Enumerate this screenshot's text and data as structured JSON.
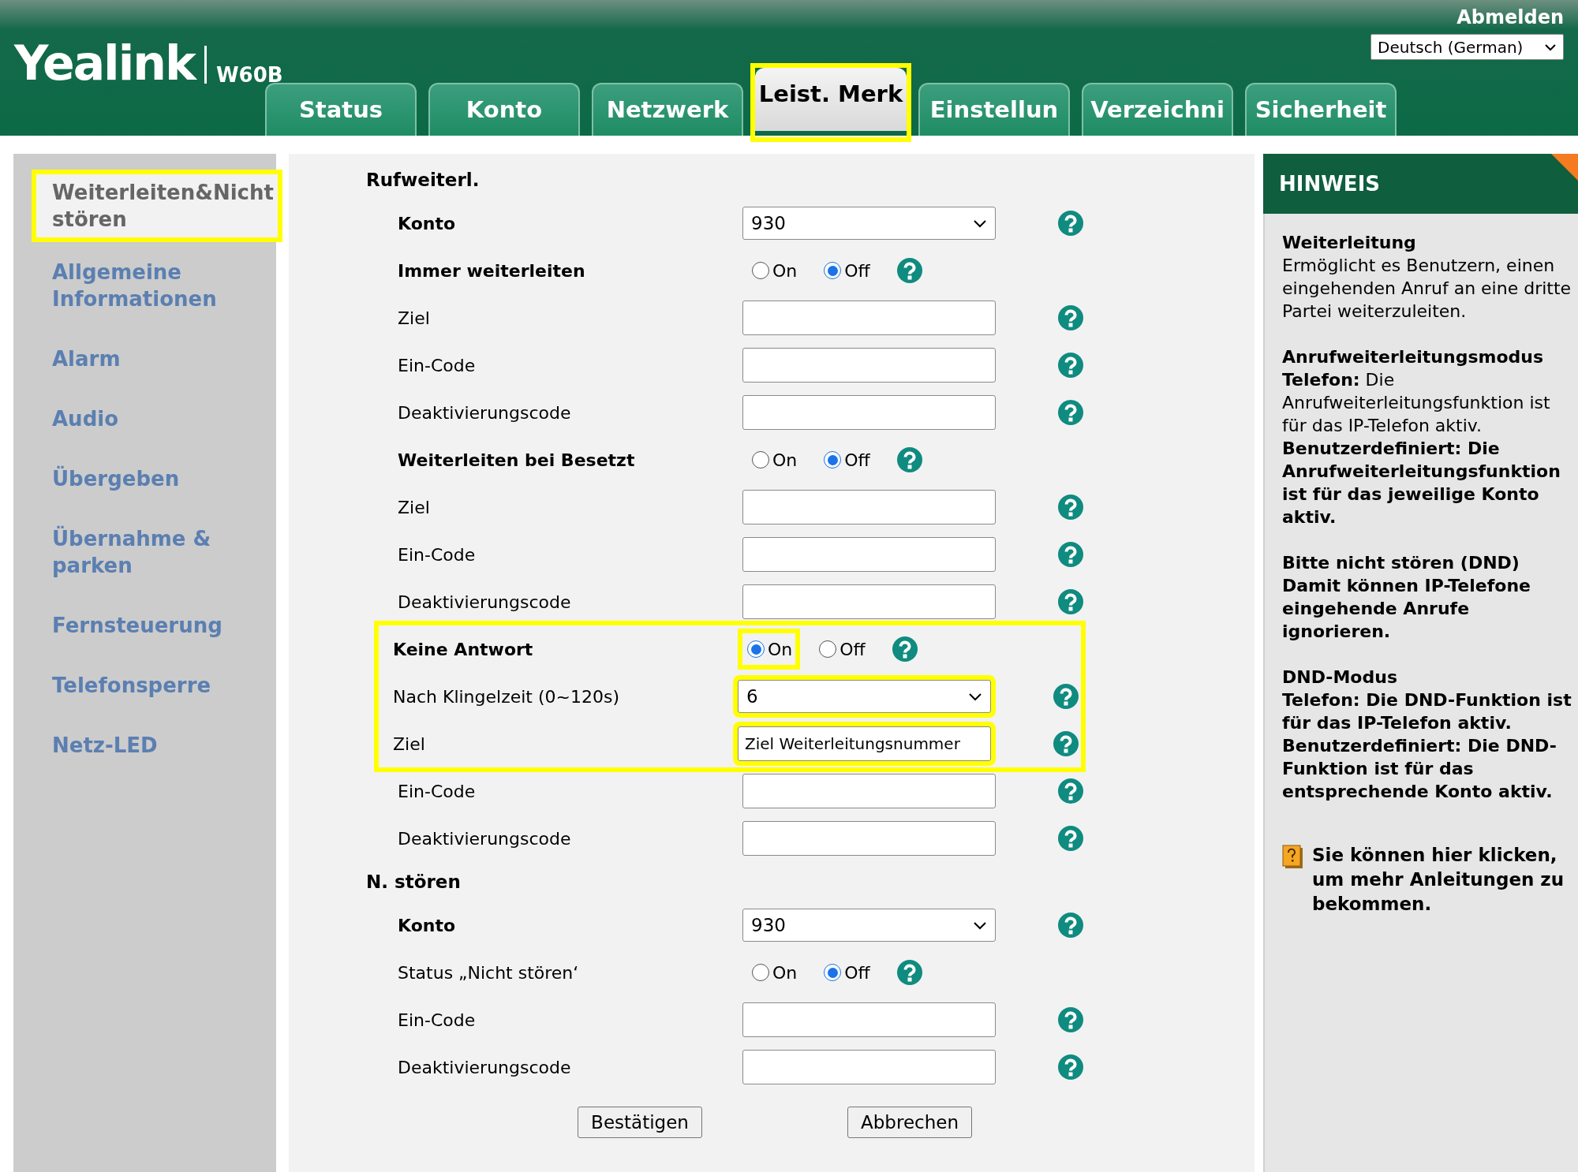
{
  "header": {
    "logo": {
      "brand": "Yealink",
      "model": "W60B"
    },
    "logout": "Abmelden",
    "language": "Deutsch (German)"
  },
  "tabs": [
    {
      "label": "Status",
      "selected": false,
      "highlighted": false
    },
    {
      "label": "Konto",
      "selected": false,
      "highlighted": false
    },
    {
      "label": "Netzwerk",
      "selected": false,
      "highlighted": false
    },
    {
      "label": "Leist. Merk",
      "selected": true,
      "highlighted": true
    },
    {
      "label": "Einstellun",
      "selected": false,
      "highlighted": false
    },
    {
      "label": "Verzeichni",
      "selected": false,
      "highlighted": false
    },
    {
      "label": "Sicherheit",
      "selected": false,
      "highlighted": false
    }
  ],
  "sidebar": {
    "items": [
      {
        "label": "Weiterleiten&Nicht stören",
        "selected": true,
        "highlighted": true
      },
      {
        "label": "Allgemeine Informationen",
        "selected": false,
        "highlighted": false
      },
      {
        "label": "Alarm",
        "selected": false,
        "highlighted": false
      },
      {
        "label": "Audio",
        "selected": false,
        "highlighted": false
      },
      {
        "label": "Übergeben",
        "selected": false,
        "highlighted": false
      },
      {
        "label": "Übernahme & parken",
        "selected": false,
        "highlighted": false
      },
      {
        "label": "Fernsteuerung",
        "selected": false,
        "highlighted": false
      },
      {
        "label": "Telefonsperre",
        "selected": false,
        "highlighted": false
      },
      {
        "label": "Netz-LED",
        "selected": false,
        "highlighted": false
      }
    ]
  },
  "sections": [
    {
      "title": "Rufweiterl.",
      "rows": [
        {
          "label": "Konto",
          "bold": true,
          "kind": "select",
          "value": "930",
          "highlighted": false
        },
        {
          "label": "Immer weiterleiten",
          "bold": true,
          "kind": "radio",
          "options": [
            {
              "label": "On",
              "selected": false
            },
            {
              "label": "Off",
              "selected": true
            }
          ],
          "highlighted": false
        },
        {
          "label": "Ziel",
          "bold": false,
          "kind": "text",
          "highlighted": false
        },
        {
          "label": "Ein-Code",
          "bold": false,
          "kind": "text",
          "highlighted": false
        },
        {
          "label": "Deaktivierungscode",
          "bold": false,
          "kind": "text",
          "highlighted": false
        },
        {
          "label": "Weiterleiten bei Besetzt",
          "bold": true,
          "kind": "radio",
          "options": [
            {
              "label": "On",
              "selected": false
            },
            {
              "label": "Off",
              "selected": true
            }
          ],
          "highlighted": false
        },
        {
          "label": "Ziel",
          "bold": false,
          "kind": "text",
          "highlighted": false
        },
        {
          "label": "Ein-Code",
          "bold": false,
          "kind": "text",
          "highlighted": false
        },
        {
          "label": "Deaktivierungscode",
          "bold": false,
          "kind": "text",
          "highlighted": false
        },
        {
          "label": "Keine Antwort",
          "bold": true,
          "kind": "radio",
          "options": [
            {
              "label": "On",
              "selected": true
            },
            {
              "label": "Off",
              "selected": false
            }
          ],
          "highlighted": true
        },
        {
          "label": "Nach Klingelzeit (0~120s)",
          "bold": false,
          "kind": "select",
          "value": "6",
          "highlighted": true
        },
        {
          "label": "Ziel",
          "bold": false,
          "kind": "text",
          "value": "Ziel Weiterleitungsnummer",
          "highlighted": true
        },
        {
          "label": "Ein-Code",
          "bold": false,
          "kind": "text",
          "highlighted": false
        },
        {
          "label": "Deaktivierungscode",
          "bold": false,
          "kind": "text",
          "highlighted": false
        }
      ]
    },
    {
      "title": "N. stören",
      "rows": [
        {
          "label": "Konto",
          "bold": true,
          "kind": "select",
          "value": "930",
          "highlighted": false
        },
        {
          "label": "Status „Nicht stören‘",
          "bold": false,
          "kind": "radio",
          "options": [
            {
              "label": "On",
              "selected": false
            },
            {
              "label": "Off",
              "selected": true
            }
          ],
          "highlighted": false
        },
        {
          "label": "Ein-Code",
          "bold": false,
          "kind": "text",
          "highlighted": false
        },
        {
          "label": "Deaktivierungscode",
          "bold": false,
          "kind": "text",
          "highlighted": false
        }
      ]
    }
  ],
  "buttons": [
    "Bestätigen",
    "Abbrechen"
  ],
  "hint": {
    "title": "HINWEIS",
    "paragraphs": [
      {
        "text": "**Weiterleitung**\nErmöglicht es Benutzern, einen eingehenden Anruf an eine dritte Partei weiterzuleiten.",
        "bold": false
      },
      {
        "text": "**Anrufweiterleitungsmodus**\n**Telefon:** Die Anrufweiterleitungsfunktion ist für das IP-Telefon aktiv.\n**Benutzerdefiniert: Die Anrufweiterleitungsfunktion ist für das jeweilige Konto aktiv.**",
        "bold": false
      },
      {
        "text": "Bitte nicht stören (DND)\nDamit können IP-Telefone eingehende Anrufe ignorieren.",
        "bold": true
      },
      {
        "text": "DND-Modus\nTelefon: Die DND-Funktion ist für das IP-Telefon aktiv.\nBenutzerdefiniert: Die DND-Funktion ist für das entsprechende Konto aktiv.",
        "bold": true
      }
    ],
    "more_link": "Sie können hier klicken, um mehr Anleitungen zu bekommen."
  }
}
